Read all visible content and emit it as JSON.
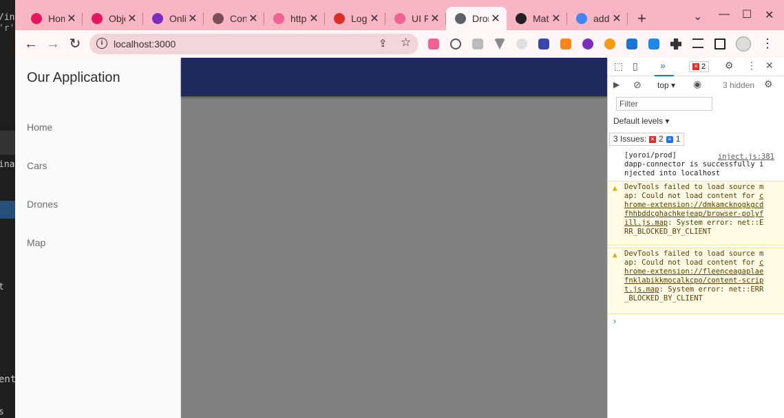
{
  "background_editor": {
    "fragments": [
      "/in",
      "'r'r",
      "inal",
      "t",
      "ent.j",
      "s"
    ]
  },
  "browser": {
    "tabs": [
      {
        "title": "Hom",
        "icon": "youtube-icon",
        "color": "#e8175d"
      },
      {
        "title": "Obje",
        "icon": "youtube-icon",
        "color": "#e8175d"
      },
      {
        "title": "Onli",
        "icon": "u-icon",
        "color": "#7b2cbf"
      },
      {
        "title": "Con",
        "icon": "tor-icon",
        "color": "#7a4f5a"
      },
      {
        "title": "http",
        "icon": "bolt-icon",
        "color": "#f06292"
      },
      {
        "title": "Logi",
        "icon": "gmail-icon",
        "color": "#d93025"
      },
      {
        "title": "UI F",
        "icon": "bolt-icon",
        "color": "#f06292"
      },
      {
        "title": "Dror",
        "icon": "globe-icon",
        "color": "#5f6368"
      },
      {
        "title": "Mat",
        "icon": "mui-icon",
        "color": "#222"
      },
      {
        "title": "add",
        "icon": "google-icon",
        "color": "#4285f4"
      }
    ],
    "active_tab": 7,
    "new_tab_label": "+",
    "url": "localhost:3000"
  },
  "app": {
    "title": "Our Application",
    "nav": [
      "Home",
      "Cars",
      "Drones",
      "Map"
    ],
    "appbar_color": "#1e2a5e"
  },
  "devtools": {
    "error_count": "2",
    "context": "top",
    "hidden": "3 hidden",
    "filter_placeholder": "Filter",
    "levels": "Default levels",
    "issues_label": "3 Issues:",
    "issues_errors": "2",
    "issues_info": "1",
    "logs": [
      {
        "type": "info",
        "text": "[yoroi/prod]\ndapp-connector is successfully injected into localhost",
        "source": "inject.js:381"
      },
      {
        "type": "warning",
        "prefix": "DevTools failed to load source map: Could not load content for ",
        "link": "chrome-extension://dmkamcknogkgcdfhhbddcghachkejeap/browser-polyfill.js.map",
        "suffix": ": System error: net::ERR_BLOCKED_BY_CLIENT"
      },
      {
        "type": "warning",
        "prefix": "DevTools failed to load source map: Could not load content for ",
        "link": "chrome-extension://fleenceagaplaefnklabikkmocalkcpo/content-script.js.map",
        "suffix": ": System error: net::ERR_BLOCKED_BY_CLIENT"
      }
    ]
  }
}
